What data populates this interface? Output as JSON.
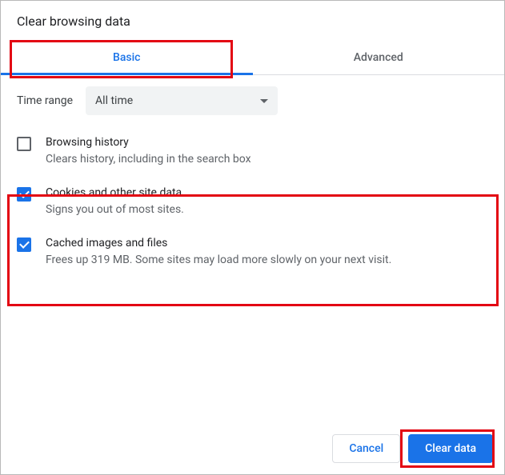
{
  "dialog": {
    "title": "Clear browsing data"
  },
  "tabs": {
    "basic": "Basic",
    "advanced": "Advanced"
  },
  "timeRange": {
    "label": "Time range",
    "value": "All time"
  },
  "options": [
    {
      "title": "Browsing history",
      "desc": "Clears history, including in the search box",
      "checked": false
    },
    {
      "title": "Cookies and other site data",
      "desc": "Signs you out of most sites.",
      "checked": true
    },
    {
      "title": "Cached images and files",
      "desc": "Frees up 319 MB. Some sites may load more slowly on your next visit.",
      "checked": true
    }
  ],
  "buttons": {
    "cancel": "Cancel",
    "confirm": "Clear data"
  },
  "highlights": {
    "color": "#e30613"
  }
}
